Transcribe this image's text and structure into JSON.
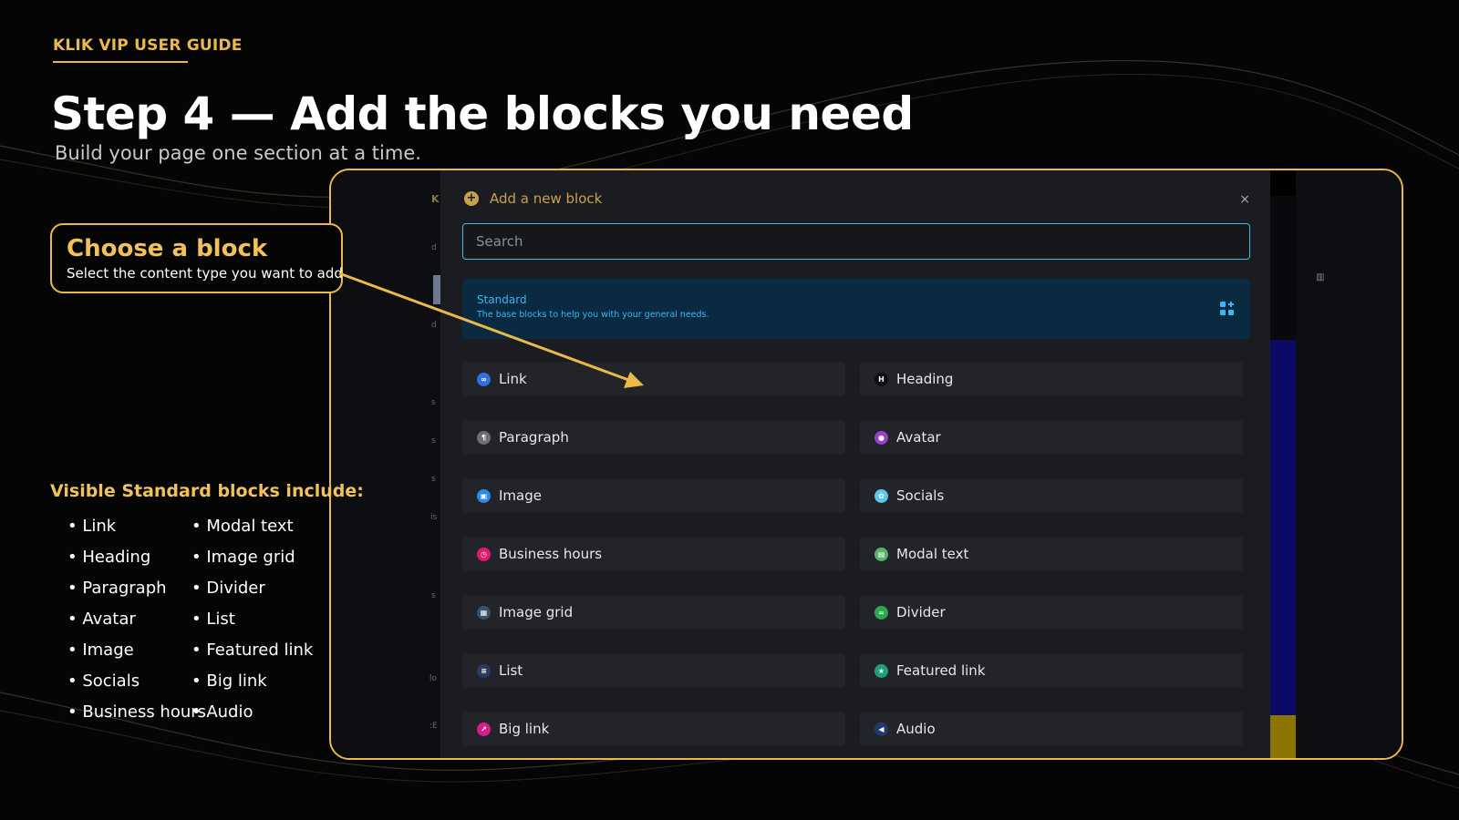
{
  "slide": {
    "eyebrow": "KLIK VIP USER GUIDE",
    "title": "Step 4 — Add the blocks you need",
    "subtitle": "Build your page one section at a time."
  },
  "callout": {
    "title": "Choose a block",
    "text": "Select the content type you want to add"
  },
  "visible_list": {
    "heading": "Visible Standard blocks include:",
    "col_a": [
      "• Link",
      "• Heading",
      "• Paragraph",
      "• Avatar",
      "• Image",
      "• Socials",
      "• Business hours"
    ],
    "col_b": [
      "• Modal text",
      "• Image grid",
      "• Divider",
      "• List",
      "• Featured link",
      "• Big link",
      "• Audio"
    ]
  },
  "modal": {
    "title": "Add a new block",
    "close_glyph": "×",
    "search_placeholder": "Search",
    "category": {
      "title": "Standard",
      "description": "The base blocks to help you with your general needs."
    },
    "blocks": [
      {
        "label": "Link",
        "icon": "link-icon",
        "color": "#2f6fe0",
        "glyph": "∞"
      },
      {
        "label": "Heading",
        "icon": "heading-icon",
        "color": "#0d0d0f",
        "glyph": "H"
      },
      {
        "label": "Paragraph",
        "icon": "paragraph-icon",
        "color": "#6d6f75",
        "glyph": "¶"
      },
      {
        "label": "Avatar",
        "icon": "avatar-icon",
        "color": "#9b3ecf",
        "glyph": "●"
      },
      {
        "label": "Image",
        "icon": "image-icon",
        "color": "#2a8ae8",
        "glyph": "▣"
      },
      {
        "label": "Socials",
        "icon": "socials-icon",
        "color": "#5ac8f0",
        "glyph": "✿"
      },
      {
        "label": "Business hours",
        "icon": "clock-icon",
        "color": "#e0196f",
        "glyph": "◷"
      },
      {
        "label": "Modal text",
        "icon": "modal-text-icon",
        "color": "#58b36a",
        "glyph": "▤"
      },
      {
        "label": "Image grid",
        "icon": "image-grid-icon",
        "color": "#3a5168",
        "glyph": "▦"
      },
      {
        "label": "Divider",
        "icon": "divider-icon",
        "color": "#2ea84f",
        "glyph": "="
      },
      {
        "label": "List",
        "icon": "list-icon",
        "color": "#2c3b66",
        "glyph": "≡"
      },
      {
        "label": "Featured link",
        "icon": "featured-link-icon",
        "color": "#1f9e7a",
        "glyph": "★"
      },
      {
        "label": "Big link",
        "icon": "big-link-icon",
        "color": "#d41e8c",
        "glyph": "↗"
      },
      {
        "label": "Audio",
        "icon": "audio-icon",
        "color": "#1e3a6e",
        "glyph": "◀"
      }
    ]
  },
  "background_fragments": {
    "left_logo": "K",
    "left_items": [
      "d",
      "d",
      "s",
      "s",
      "s",
      "is",
      "s",
      "lo",
      ":E"
    ]
  },
  "colors": {
    "accent": "#e9b949",
    "background": "#050506",
    "modal_bg": "#1b1c21",
    "category_bg": "#0a2a42",
    "category_text": "#3fb4f0",
    "search_border": "#46b9e6"
  }
}
